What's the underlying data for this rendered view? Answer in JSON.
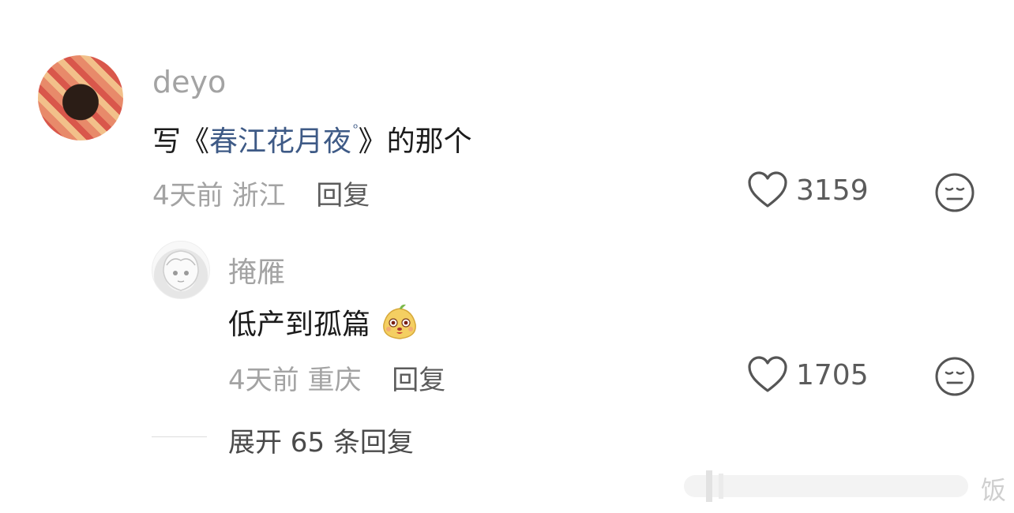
{
  "comment": {
    "username": "deyo",
    "text_prefix": "写《",
    "text_link": "春江花月夜",
    "text_suffix": "》的那个",
    "time": "4天前",
    "location": "浙江",
    "reply_label": "回复",
    "likes": "3159"
  },
  "reply": {
    "username": "掩雁",
    "text": "低产到孤篇",
    "time": "4天前",
    "location": "重庆",
    "reply_label": "回复",
    "likes": "1705"
  },
  "expand_label": "展开 65 条回复",
  "watermark_text": "饭",
  "icons": {
    "like": "heart-outline-icon",
    "dislike": "neutral-face-icon",
    "search": "search-icon",
    "emoji": "pear-face-emoji"
  },
  "colors": {
    "link": "#3e5a86",
    "muted": "#a3a3a3",
    "text": "#1b1b1b"
  }
}
